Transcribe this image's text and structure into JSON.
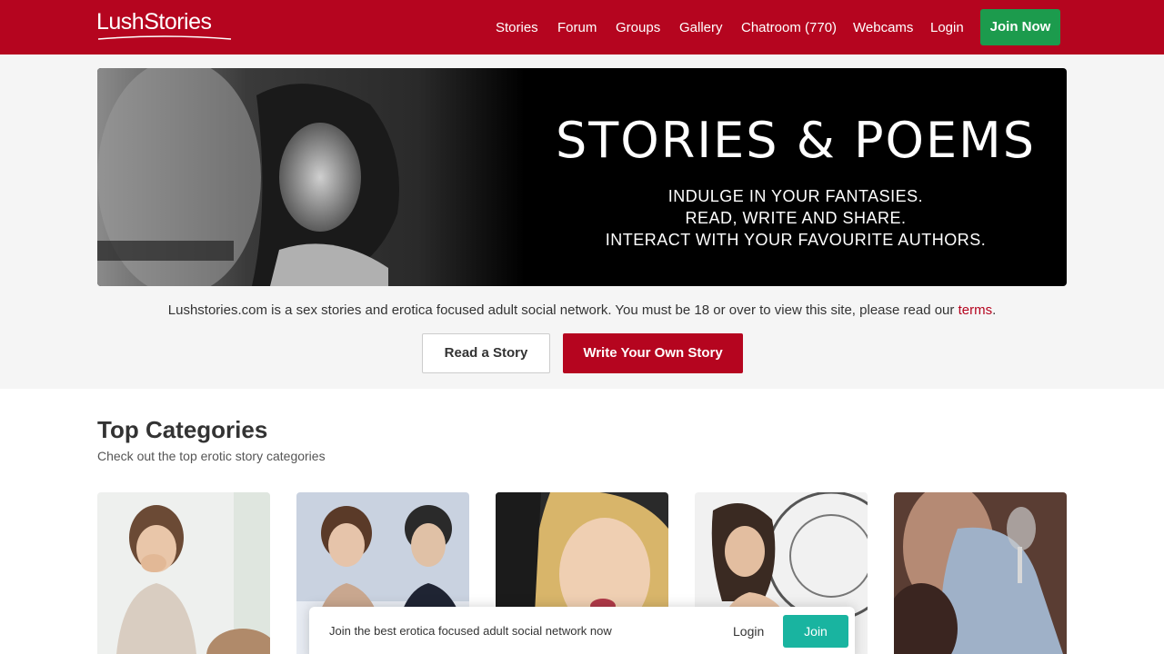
{
  "header": {
    "logo_text": "LushStories",
    "nav": [
      {
        "label": "Stories"
      },
      {
        "label": "Forum"
      },
      {
        "label": "Groups"
      },
      {
        "label": "Gallery"
      },
      {
        "label": "Chatroom (770)"
      },
      {
        "label": "Webcams"
      },
      {
        "label": "Login"
      }
    ],
    "join_label": "Join Now"
  },
  "hero": {
    "title": "STORIES & POEMS",
    "lines": [
      "INDULGE IN YOUR FANTASIES.",
      "READ, WRITE AND SHARE.",
      "INTERACT WITH YOUR FAVOURITE AUTHORS."
    ]
  },
  "intro": {
    "text": "Lushstories.com is a sex stories and erotica focused adult social network. You must be 18 or over to view this site, please read our ",
    "link_text": "terms",
    "suffix": "."
  },
  "actions": {
    "read_label": "Read a Story",
    "write_label": "Write Your Own Story"
  },
  "categories": {
    "title": "Top Categories",
    "subtitle": "Check out the top erotic story categories"
  },
  "join_bar": {
    "text": "Join the best erotica focused adult social network now",
    "login_label": "Login",
    "join_label": "Join"
  },
  "colors": {
    "brand_red": "#b5051f",
    "join_green": "#1c9b4d",
    "join_teal": "#19b4a0"
  }
}
